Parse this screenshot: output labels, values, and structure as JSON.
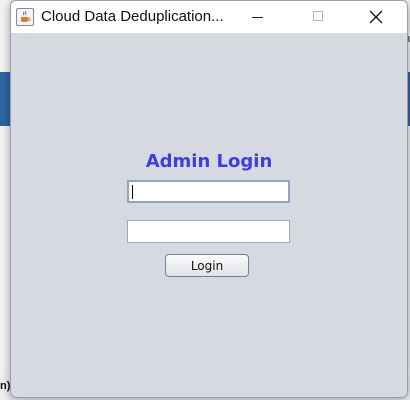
{
  "background": {
    "right_fragment": "t\nn",
    "bottom_left_fragment": "n)"
  },
  "window": {
    "title": "Cloud Data Deduplication...",
    "icons": {
      "app": "java-cup-icon",
      "minimize": "minimize-icon",
      "maximize": "maximize-icon",
      "close": "close-icon"
    }
  },
  "form": {
    "heading": "Admin Login",
    "username_value": "",
    "password_value": "",
    "login_label": "Login"
  },
  "colors": {
    "heading": "#3d3de6",
    "window_bg": "#d6d9e1",
    "bg_band": "#2f64a6"
  }
}
